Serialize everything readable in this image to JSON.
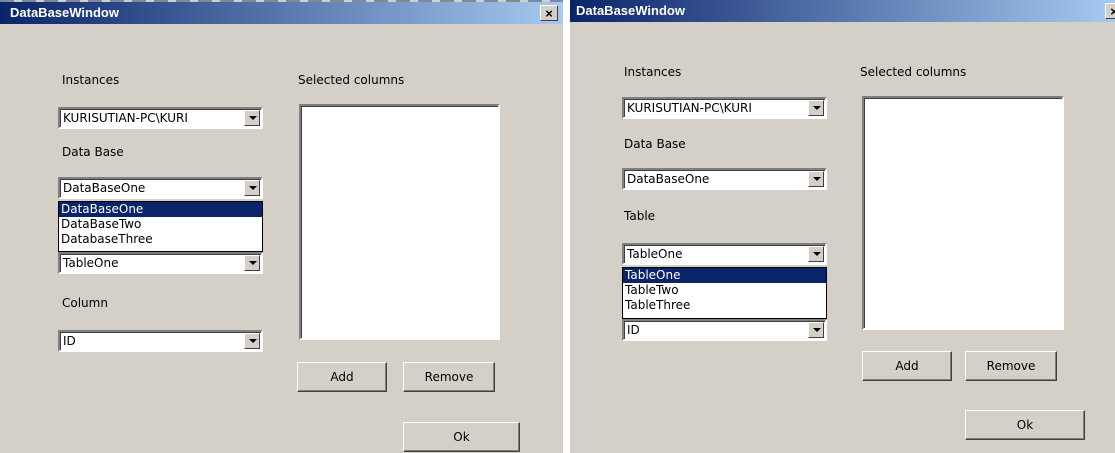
{
  "window_title": "DataBaseWindow",
  "close_glyph": "×",
  "labels": {
    "instances": "Instances",
    "selected_columns": "Selected columns",
    "database": "Data Base",
    "table": "Table",
    "column": "Column"
  },
  "values": {
    "instance": "KURISUTIAN-PC\\KURI",
    "database": "DataBaseOne",
    "table": "TableOne",
    "column": "ID"
  },
  "database_options": [
    "DataBaseOne",
    "DataBaseTwo",
    "DatabaseThree"
  ],
  "table_options": [
    "TableOne",
    "TableTwo",
    "TableThree"
  ],
  "buttons": {
    "add": "Add",
    "remove": "Remove",
    "ok": "Ok"
  }
}
